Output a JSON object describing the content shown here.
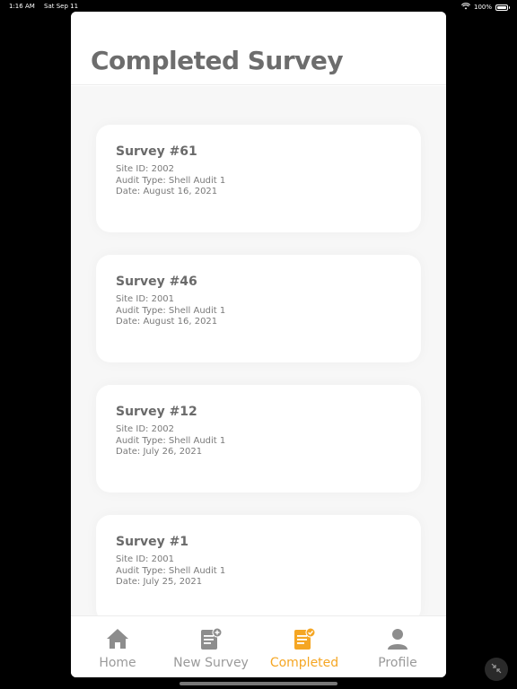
{
  "status_bar": {
    "time": "1:16 AM",
    "date": "Sat Sep 11",
    "battery": "100%",
    "battery_level": 1.0
  },
  "page": {
    "title": "Completed Survey"
  },
  "surveys": [
    {
      "title": "Survey  #61",
      "site": "Site ID: 2002",
      "audit": "Audit Type: Shell Audit 1",
      "date": "Date: August 16, 2021"
    },
    {
      "title": "Survey  #46",
      "site": "Site ID: 2001",
      "audit": "Audit Type: Shell Audit 1",
      "date": "Date: August 16, 2021"
    },
    {
      "title": "Survey  #12",
      "site": "Site ID: 2002",
      "audit": "Audit Type: Shell Audit 1",
      "date": "Date: July 26, 2021"
    },
    {
      "title": "Survey  #1",
      "site": "Site ID: 2001",
      "audit": "Audit Type: Shell Audit 1",
      "date": "Date: July 25, 2021"
    }
  ],
  "tabs": [
    {
      "label": "Home",
      "icon": "home-icon"
    },
    {
      "label": "New Survey",
      "icon": "new-survey-icon"
    },
    {
      "label": "Completed",
      "icon": "completed-icon",
      "active": true
    },
    {
      "label": "Profile",
      "icon": "profile-icon"
    }
  ],
  "colors": {
    "accent": "#f5a623",
    "inactive": "#9a9a9a",
    "title": "#6d6d6d"
  }
}
